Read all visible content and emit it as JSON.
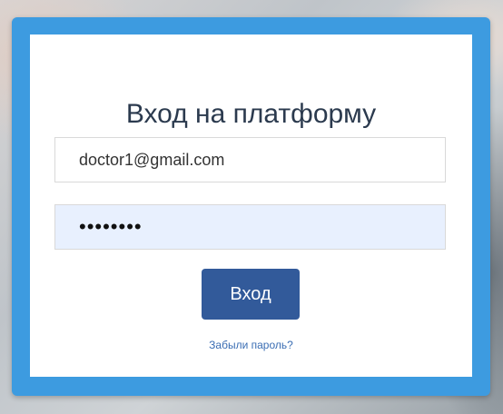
{
  "login": {
    "title": "Вход на платформу",
    "email_value": "doctor1@gmail.com",
    "password_value": "••••••••",
    "submit_label": "Вход",
    "forgot_link": "Забыли пароль?"
  },
  "colors": {
    "frame": "#3d9be0",
    "button": "#325a9a",
    "link": "#3a6db3",
    "title": "#2b3a4e",
    "autofill_bg": "#e8f0fe"
  }
}
